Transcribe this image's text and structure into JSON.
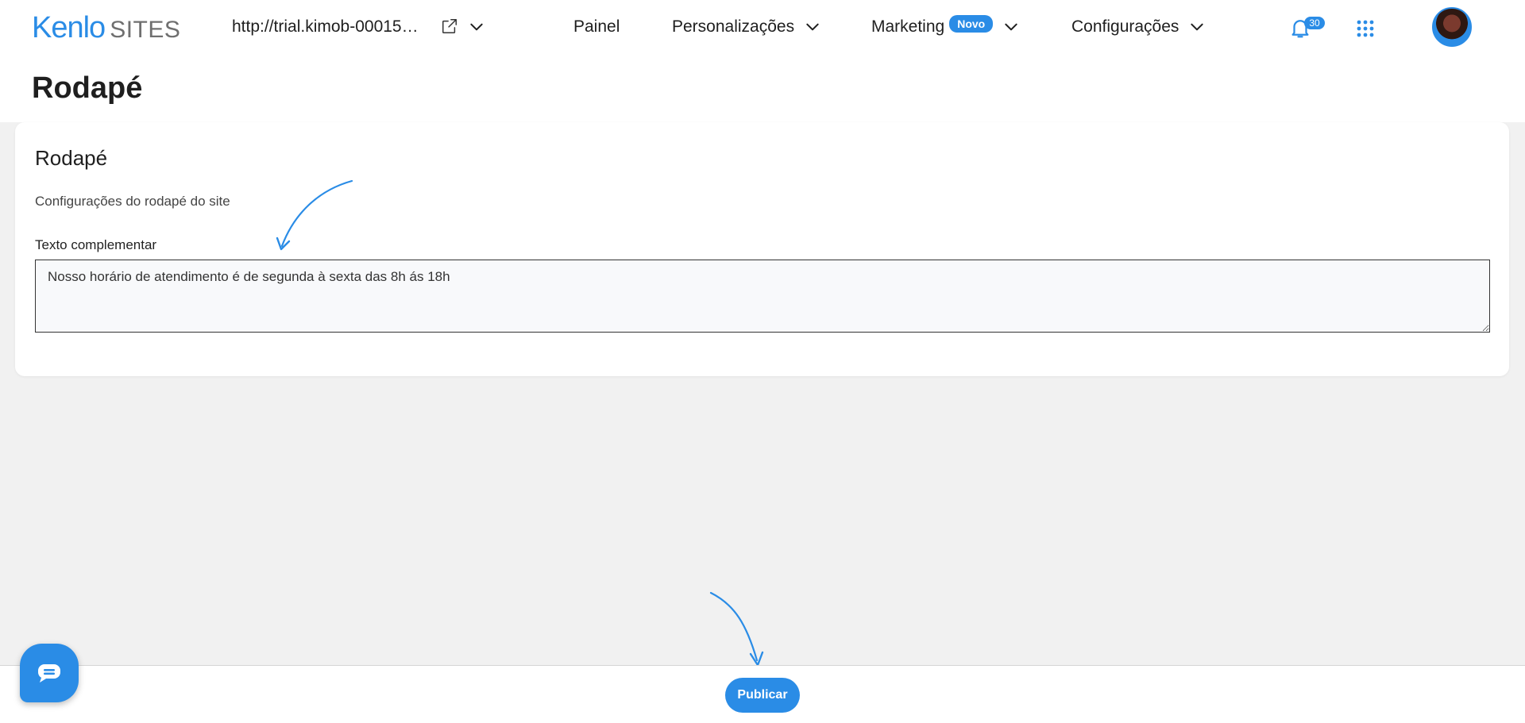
{
  "brand": {
    "primary": "Kenlo",
    "secondary": "SITES",
    "accent_color": "#2a8ce6"
  },
  "topbar": {
    "site_url": "http://trial.kimob-0001524...",
    "nav": {
      "painel": "Painel",
      "personalizacoes": "Personalizações",
      "marketing": "Marketing",
      "marketing_badge": "Novo",
      "configuracoes": "Configurações"
    },
    "notifications_count": "30",
    "icons": [
      "external-link-icon",
      "chevron-down-icon",
      "bell-icon",
      "apps-grid-icon",
      "avatar"
    ]
  },
  "page": {
    "title": "Rodapé"
  },
  "card": {
    "title": "Rodapé",
    "description": "Configurações do rodapé do site",
    "field_label": "Texto complementar",
    "field_value": "Nosso horário de atendimento é de segunda à sexta das 8h ás 18h"
  },
  "footer_bar": {
    "publish_label": "Publicar"
  },
  "chat": {
    "icon": "chat-bubble-icon"
  }
}
